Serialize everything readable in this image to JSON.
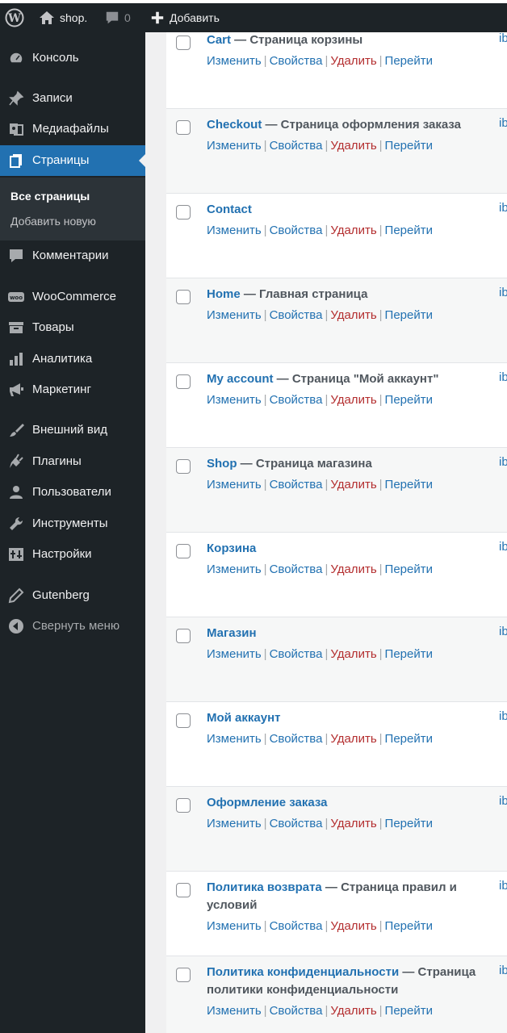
{
  "adminbar": {
    "site_name": "shop.",
    "comments_count": "0",
    "new_label": "Добавить"
  },
  "sidebar": {
    "items": [
      {
        "label": "Консоль",
        "icon": "dashboard-icon"
      },
      {
        "label": "Записи",
        "icon": "pushpin-icon"
      },
      {
        "label": "Медиафайлы",
        "icon": "media-icon"
      },
      {
        "label": "Страницы",
        "icon": "pages-icon",
        "current": true
      },
      {
        "label": "Комментарии",
        "icon": "comment-icon"
      },
      {
        "label": "WooCommerce",
        "icon": "woo-icon"
      },
      {
        "label": "Товары",
        "icon": "archive-icon"
      },
      {
        "label": "Аналитика",
        "icon": "chart-bar-icon"
      },
      {
        "label": "Маркетинг",
        "icon": "megaphone-icon"
      },
      {
        "label": "Внешний вид",
        "icon": "paint-brush-icon"
      },
      {
        "label": "Плагины",
        "icon": "plugin-icon"
      },
      {
        "label": "Пользователи",
        "icon": "user-icon"
      },
      {
        "label": "Инструменты",
        "icon": "wrench-icon"
      },
      {
        "label": "Настройки",
        "icon": "settings-icon"
      },
      {
        "label": "Gutenberg",
        "icon": "pencil-icon"
      },
      {
        "label": "Свернуть меню",
        "icon": "collapse-icon"
      }
    ],
    "submenu": {
      "all_pages": "Все страницы",
      "add_new": "Добавить новую"
    }
  },
  "row_actions": {
    "edit": "Изменить",
    "quick_edit": "Свойства",
    "trash": "Удалить",
    "view": "Перейти"
  },
  "author_fragment": "ib",
  "pages": [
    {
      "title": "Cart",
      "state": " — Страница корзины"
    },
    {
      "title": "Checkout",
      "state": " — Страница оформления заказа"
    },
    {
      "title": "Contact",
      "state": ""
    },
    {
      "title": "Home",
      "state": " — Главная страница"
    },
    {
      "title": "My account",
      "state": " — Страница \"Мой аккаунт\""
    },
    {
      "title": "Shop",
      "state": " — Страница магазина"
    },
    {
      "title": "Корзина",
      "state": ""
    },
    {
      "title": "Магазин",
      "state": ""
    },
    {
      "title": "Мой аккаунт",
      "state": ""
    },
    {
      "title": "Оформление заказа",
      "state": ""
    },
    {
      "title": "Политика возврата",
      "state": " — Страница правил и условий"
    },
    {
      "title": "Политика конфиденциальности",
      "state": " — Страница политики конфиденциальности"
    }
  ]
}
